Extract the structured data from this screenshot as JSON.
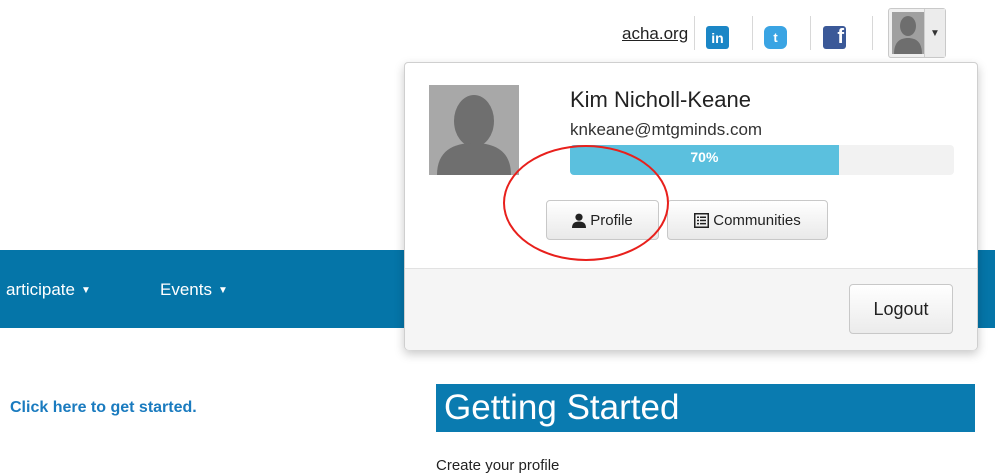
{
  "utility_bar": {
    "site_link": "acha.org",
    "linkedin_glyph": "in",
    "twitter_glyph": "t",
    "facebook_glyph": "f"
  },
  "user_menu": {
    "name": "Kim Nicholl-Keane",
    "email": "knkeane@mtgminds.com",
    "profile_completion": 70,
    "profile_completion_label": "70%",
    "profile_button": "Profile",
    "communities_button": "Communities",
    "logout_button": "Logout"
  },
  "nav": {
    "items": [
      {
        "label": "articipate"
      },
      {
        "label": "Events"
      }
    ]
  },
  "content": {
    "get_started_link": "Click here to get started.",
    "section_title": "Getting Started",
    "section_subtitle": "Create your profile"
  },
  "colors": {
    "nav_bg": "#0575a8",
    "progress": "#5bc0de",
    "link": "#1a7bbf",
    "annotation": "#e8201c"
  },
  "icons": [
    "linkedin-icon",
    "twitter-icon",
    "facebook-icon",
    "user-icon",
    "list-icon",
    "caret-down-icon"
  ]
}
